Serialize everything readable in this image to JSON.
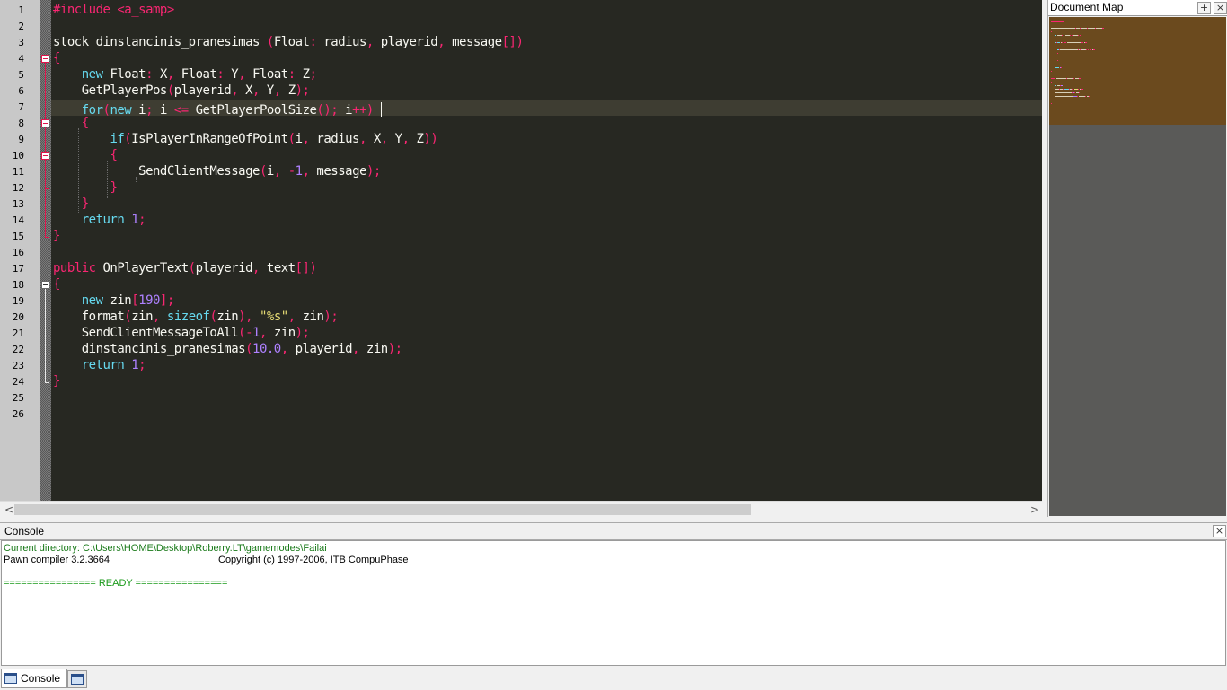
{
  "editor": {
    "line_numbers": [
      "1",
      "2",
      "3",
      "4",
      "5",
      "6",
      "7",
      "8",
      "9",
      "10",
      "11",
      "12",
      "13",
      "14",
      "15",
      "16",
      "17",
      "18",
      "19",
      "20",
      "21",
      "22",
      "23",
      "24",
      "25",
      "26"
    ],
    "lines": [
      [
        [
          "pp",
          "#include <a_samp>"
        ]
      ],
      [],
      [
        [
          "t",
          "stock dinstancinis_pranesimas "
        ],
        [
          "p",
          "("
        ],
        [
          "t",
          "Float"
        ],
        [
          "p",
          ":"
        ],
        [
          "t",
          " radius"
        ],
        [
          "p",
          ","
        ],
        [
          "t",
          " playerid"
        ],
        [
          "p",
          ","
        ],
        [
          "t",
          " message"
        ],
        [
          "p",
          "[])"
        ]
      ],
      [
        [
          "p",
          "{"
        ]
      ],
      [
        [
          "t",
          "    "
        ],
        [
          "k",
          "new"
        ],
        [
          "t",
          " Float"
        ],
        [
          "p",
          ":"
        ],
        [
          "t",
          " X"
        ],
        [
          "p",
          ","
        ],
        [
          "t",
          " Float"
        ],
        [
          "p",
          ":"
        ],
        [
          "t",
          " Y"
        ],
        [
          "p",
          ","
        ],
        [
          "t",
          " Float"
        ],
        [
          "p",
          ":"
        ],
        [
          "t",
          " Z"
        ],
        [
          "p",
          ";"
        ]
      ],
      [
        [
          "t",
          "    GetPlayerPos"
        ],
        [
          "p",
          "("
        ],
        [
          "t",
          "playerid"
        ],
        [
          "p",
          ","
        ],
        [
          "t",
          " X"
        ],
        [
          "p",
          ","
        ],
        [
          "t",
          " Y"
        ],
        [
          "p",
          ","
        ],
        [
          "t",
          " Z"
        ],
        [
          "p",
          ");"
        ]
      ],
      [
        [
          "t",
          "    "
        ],
        [
          "k",
          "for"
        ],
        [
          "p",
          "("
        ],
        [
          "k",
          "new"
        ],
        [
          "t",
          " i"
        ],
        [
          "p",
          ";"
        ],
        [
          "t",
          " i "
        ],
        [
          "p",
          "<="
        ],
        [
          "t",
          " GetPlayerPoolSize"
        ],
        [
          "p",
          "();"
        ],
        [
          "t",
          " i"
        ],
        [
          "p",
          "++)"
        ],
        [
          "t",
          " "
        ]
      ],
      [
        [
          "t",
          "    "
        ],
        [
          "p",
          "{"
        ]
      ],
      [
        [
          "t",
          "        "
        ],
        [
          "k",
          "if"
        ],
        [
          "p",
          "("
        ],
        [
          "t",
          "IsPlayerInRangeOfPoint"
        ],
        [
          "p",
          "("
        ],
        [
          "t",
          "i"
        ],
        [
          "p",
          ","
        ],
        [
          "t",
          " radius"
        ],
        [
          "p",
          ","
        ],
        [
          "t",
          " X"
        ],
        [
          "p",
          ","
        ],
        [
          "t",
          " Y"
        ],
        [
          "p",
          ","
        ],
        [
          "t",
          " Z"
        ],
        [
          "p",
          "))"
        ]
      ],
      [
        [
          "t",
          "        "
        ],
        [
          "p",
          "{"
        ]
      ],
      [
        [
          "t",
          "            SendClientMessage"
        ],
        [
          "p",
          "("
        ],
        [
          "t",
          "i"
        ],
        [
          "p",
          ","
        ],
        [
          "t",
          " "
        ],
        [
          "p",
          "-"
        ],
        [
          "n",
          "1"
        ],
        [
          "p",
          ","
        ],
        [
          "t",
          " message"
        ],
        [
          "p",
          ");"
        ]
      ],
      [
        [
          "t",
          "        "
        ],
        [
          "p",
          "}"
        ]
      ],
      [
        [
          "t",
          "    "
        ],
        [
          "p",
          "}"
        ]
      ],
      [
        [
          "t",
          "    "
        ],
        [
          "k",
          "return"
        ],
        [
          "t",
          " "
        ],
        [
          "n",
          "1"
        ],
        [
          "p",
          ";"
        ]
      ],
      [
        [
          "p",
          "}"
        ]
      ],
      [],
      [
        [
          "p",
          "public"
        ],
        [
          "t",
          " OnPlayerText"
        ],
        [
          "p",
          "("
        ],
        [
          "t",
          "playerid"
        ],
        [
          "p",
          ","
        ],
        [
          "t",
          " text"
        ],
        [
          "p",
          "[])"
        ]
      ],
      [
        [
          "p",
          "{"
        ]
      ],
      [
        [
          "t",
          "    "
        ],
        [
          "k",
          "new"
        ],
        [
          "t",
          " zin"
        ],
        [
          "p",
          "["
        ],
        [
          "n",
          "190"
        ],
        [
          "p",
          "];"
        ]
      ],
      [
        [
          "t",
          "    format"
        ],
        [
          "p",
          "("
        ],
        [
          "t",
          "zin"
        ],
        [
          "p",
          ","
        ],
        [
          "t",
          " "
        ],
        [
          "k",
          "sizeof"
        ],
        [
          "p",
          "("
        ],
        [
          "t",
          "zin"
        ],
        [
          "p",
          "),"
        ],
        [
          "t",
          " "
        ],
        [
          "s",
          "\"%s\""
        ],
        [
          "p",
          ","
        ],
        [
          "t",
          " zin"
        ],
        [
          "p",
          ");"
        ]
      ],
      [
        [
          "t",
          "    SendClientMessageToAll"
        ],
        [
          "p",
          "("
        ],
        [
          "p",
          "-"
        ],
        [
          "n",
          "1"
        ],
        [
          "p",
          ","
        ],
        [
          "t",
          " zin"
        ],
        [
          "p",
          ");"
        ]
      ],
      [
        [
          "t",
          "    dinstancinis_pranesimas"
        ],
        [
          "p",
          "("
        ],
        [
          "n",
          "10.0"
        ],
        [
          "p",
          ","
        ],
        [
          "t",
          " playerid"
        ],
        [
          "p",
          ","
        ],
        [
          "t",
          " zin"
        ],
        [
          "p",
          ");"
        ]
      ],
      [
        [
          "t",
          "    "
        ],
        [
          "k",
          "return"
        ],
        [
          "t",
          " "
        ],
        [
          "n",
          "1"
        ],
        [
          "p",
          ";"
        ]
      ],
      [
        [
          "p",
          "}"
        ]
      ],
      [],
      []
    ],
    "current_line": 7,
    "colors": {
      "background": "#272822",
      "keyword": "#66d9ef",
      "punct": "#f92672",
      "number": "#ae81ff",
      "string": "#e6db74",
      "text": "#f8f8f2"
    }
  },
  "document_map": {
    "title": "Document Map",
    "add_glyph": "+",
    "close_glyph": "×"
  },
  "console": {
    "title": "Console",
    "close_glyph": "×",
    "current_directory": "Current directory: C:\\Users\\HOME\\Desktop\\Roberry.LT\\gamemodes\\Failai",
    "compiler": "Pawn compiler 3.2.3664",
    "copyright": "Copyright (c) 1997-2006, ITB CompuPhase",
    "status": "================ READY ================"
  },
  "bottom_tabs": {
    "console_label": "Console"
  },
  "scrollbar": {
    "left_arrow": "<",
    "right_arrow": ">"
  }
}
